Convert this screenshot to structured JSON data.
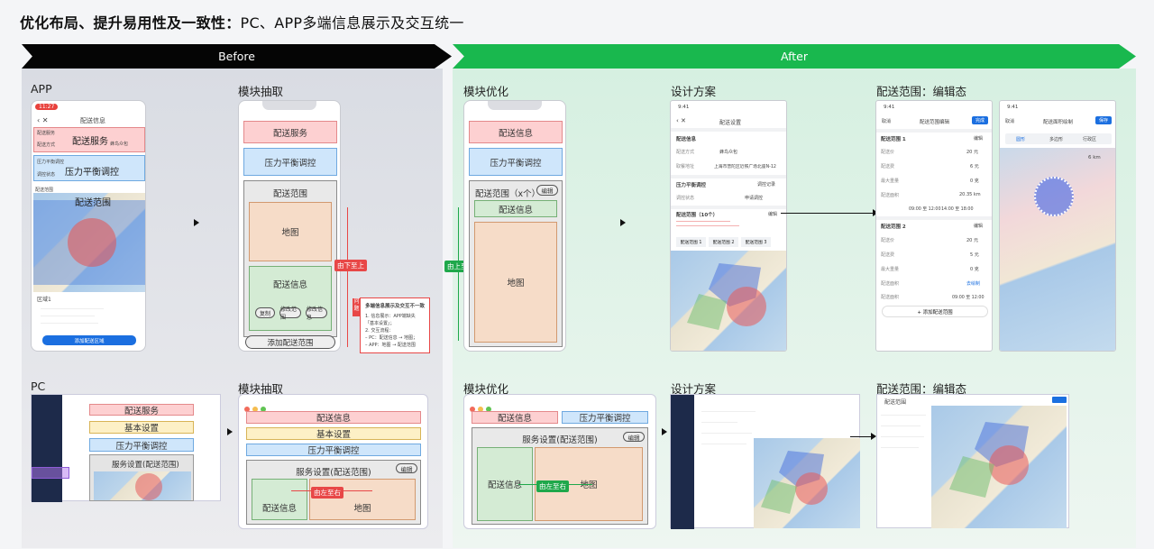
{
  "heading": {
    "bold": "优化布局、提升易用性及一致性：",
    "rest": "PC、APP多端信息展示及交互统一"
  },
  "bands": {
    "before": "Before",
    "after": "After"
  },
  "labels": {
    "app": "APP",
    "pc": "PC",
    "extract": "模块抽取",
    "optimize": "模块优化",
    "design": "设计方案",
    "edit_state": "配送范围：编辑态"
  },
  "app_original": {
    "status_time": "11:27",
    "title": "配送信息",
    "delivery_service": "配送服务",
    "delivery_mode": "配送方式",
    "pickup": "蜂鸟众包",
    "pressure": "压力平衡调控",
    "pressure_label": "压力平衡调控",
    "adjust_state": "调控状态",
    "range": "配送范围",
    "range_row": "配送范围",
    "area_title": "区域1",
    "add_btn": "添加配送区域"
  },
  "app_extract": {
    "service": "配送服务",
    "pressure": "压力平衡调控",
    "range": "配送范围",
    "map": "地图",
    "info": "配送信息",
    "chips": [
      "复制",
      "修改范围",
      "修改信息"
    ],
    "add": "添加配送范围",
    "arrow_tag": "由下至上"
  },
  "note": {
    "badge": "问题",
    "title": "多端信息展示及交互不一致",
    "lines": [
      "1. 信息展示：APP端缺失",
      "「基本设置」；",
      "2. 交互流程：",
      "– PC：配送信息 → 地图；",
      "– APP：地图 → 配送范围"
    ]
  },
  "app_optimize": {
    "service": "配送信息",
    "pressure": "压力平衡调控",
    "range": "配送范围（x个）",
    "edit": "编辑",
    "info": "配送信息",
    "map": "地图",
    "arrow_tag": "由上至下"
  },
  "app_design": {
    "time": "9:41",
    "title": "配送设置",
    "sec1": "配送信息",
    "mode_label": "配送方式",
    "mode_value": "蜂鸟众包",
    "addr_label": "取餐地址",
    "addr_value": "上海市普陀区近铁广场北座N-12",
    "sec2": "压力平衡调控",
    "sec2_link": "调控记录",
    "adj_label": "调控状态",
    "adj_value": "申请调控",
    "sec3": "配送范围（10个）",
    "sec3_edit": "编辑",
    "tabs": [
      "配送范围 1",
      "配送范围 2",
      "配送范围 3"
    ]
  },
  "app_edit": {
    "time": "9:41",
    "cancel": "取消",
    "title": "配送范围编辑",
    "done": "完成",
    "r1": "配送范围 1",
    "r1_edit": "编辑",
    "rows1": [
      [
        "配送价",
        "20 元"
      ],
      [
        "配送费",
        "6 元"
      ],
      [
        "最大重量",
        "0 克"
      ],
      [
        "配送面积",
        "20.35 km"
      ]
    ],
    "times": [
      "09:00 至 12:00",
      "14:00 至 18:00"
    ],
    "r2": "配送范围 2",
    "r2_edit": "编辑",
    "rows2": [
      [
        "配送价",
        "20 元"
      ],
      [
        "配送费",
        "5 元"
      ],
      [
        "最大重量",
        "0 克"
      ],
      [
        "配送面积",
        "去绘制"
      ],
      [
        "配送时段",
        "09:00 至 12:00"
      ]
    ],
    "add": "+ 添加配送范围"
  },
  "app_draw": {
    "time": "9:41",
    "cancel": "取消",
    "title": "配送面积绘制",
    "done": "保存",
    "tabs": [
      "圆形",
      "多边形",
      "行政区"
    ],
    "radius": "6 km"
  },
  "pc_original": {
    "blocks": [
      "配送服务",
      "基本设置",
      "压力平衡调控"
    ],
    "card_title": "服务设置(配送范围)"
  },
  "pc_extract": {
    "blocks": [
      "配送信息",
      "基本设置",
      "压力平衡调控"
    ],
    "card_title": "服务设置(配送范围)",
    "edit": "编辑",
    "info": "配送信息",
    "map": "地图",
    "arrow_tag": "由左至右"
  },
  "pc_optimize": {
    "left": "配送信息",
    "right": "压力平衡调控",
    "card_title": "服务设置(配送范围)",
    "edit": "编辑",
    "info": "配送信息",
    "map": "地图",
    "arrow_tag": "由左至右"
  },
  "pc_edit": {
    "title": "配送范围"
  }
}
